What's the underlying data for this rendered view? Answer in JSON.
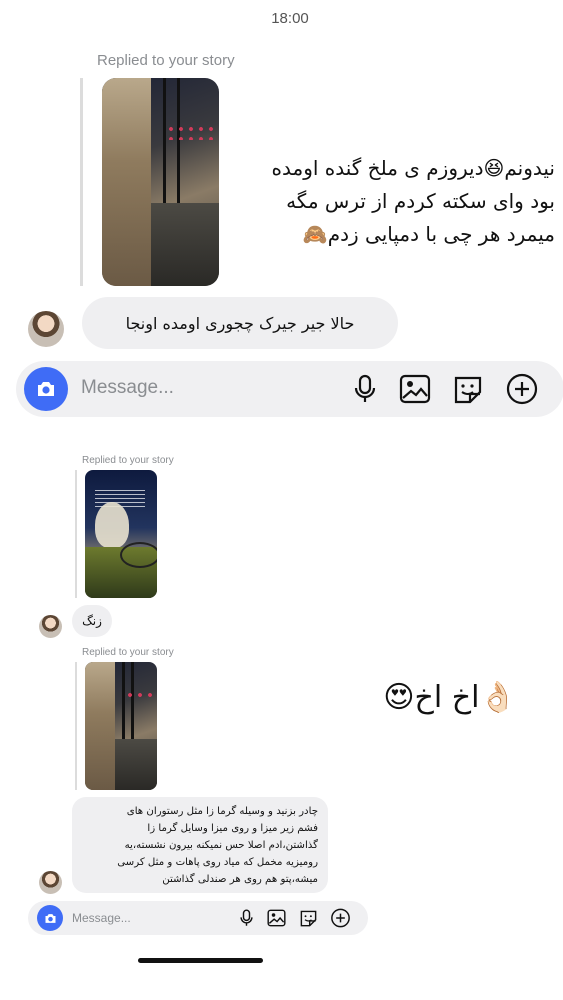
{
  "status_bar": {
    "time": "18:00"
  },
  "top": {
    "replied_label": "Replied to your story",
    "caption": "نیدونم😆دیروزم ی ملخ گنده اومده بود وای سکته کردم از ترس مگه میمرد هر چی با دمپایی زدم🙈",
    "caption_lines": [
      "نیدونم😆دیروزم ی ملخ گنده اومده",
      "بود وای سکته کردم از ترس مگه",
      "میمرد هر چی با دمپایی زدم🙈"
    ],
    "message": "حالا جیر جیرک چجوری اومده اونجا",
    "composer": {
      "placeholder": "Message..."
    }
  },
  "bottom": {
    "reply1": {
      "replied_label": "Replied to your story",
      "message": "زنگ"
    },
    "reply2": {
      "replied_label": "Replied to your story",
      "message_lines": [
        "چادر بزنید و وسیله گرما زا مثل رستوران های",
        "فشم زیر میزا و روی میزا وسایل گرما زا",
        "گذاشتن،ادم اصلا حس نمیکنه بیرون نشسته،یه",
        "رومیزیه مخمل که میاد روی پاهات و مثل کرسی",
        "میشه،پتو هم روی هر صندلی گذاشتن"
      ]
    },
    "caption": "😍اخ اخ👌🏻",
    "composer": {
      "placeholder": "Message..."
    }
  },
  "icons": [
    "camera-icon",
    "microphone-icon",
    "gallery-icon",
    "sticker-icon",
    "plus-icon"
  ],
  "colors": {
    "accent": "#3f6cf6",
    "bubble": "#efeff1",
    "muted": "#8a8d91"
  }
}
